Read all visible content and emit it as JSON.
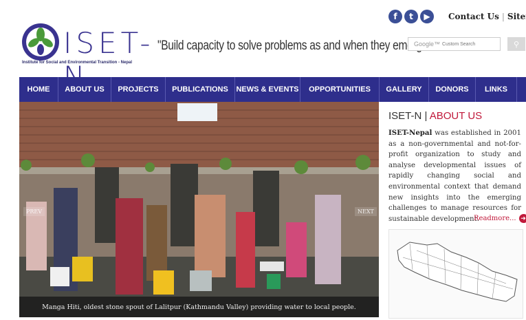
{
  "header": {
    "social_icons": [
      "facebook-icon",
      "twitter-icon",
      "youtube-icon"
    ],
    "contact_label": "Contact Us",
    "sitemap_label": "Sitemap",
    "logo_word": "ISET-N",
    "logo_full_name": "Institute for Social and Environmental Transition - Nepal",
    "tagline": "\"Build capacity to solve problems as and when they emerge\"",
    "search_brand": "Google™",
    "search_placeholder": "Custom Search"
  },
  "nav": {
    "items": [
      "HOME",
      "ABOUT US",
      "PROJECTS",
      "PUBLICATIONS",
      "NEWS & EVENTS",
      "OPPORTUNITIES",
      "GALLERY",
      "DONORS",
      "LINKS"
    ]
  },
  "slider": {
    "prev_label": "PREV",
    "next_label": "NEXT",
    "caption": "Manga Hiti, oldest stone spout of Lalitpur (Kathmandu Valley) providing water to local people."
  },
  "about": {
    "title_prefix": "ISET-N",
    "title_sep": " | ",
    "title_suffix": "ABOUT US",
    "org_name": "ISET-Nepal",
    "body": " was established in 2001 as a non-governmental and not-for-profit organization to study and analyse developmental issues of rapidly changing social and environmental context that demand new insights into the emerging challenges to manage resources for sustainable development.",
    "readmore_label": "Readmore..."
  },
  "colors": {
    "nav_bg": "#2e2e8c",
    "accent_red": "#c0183a",
    "brand_purple": "#3a3390"
  }
}
